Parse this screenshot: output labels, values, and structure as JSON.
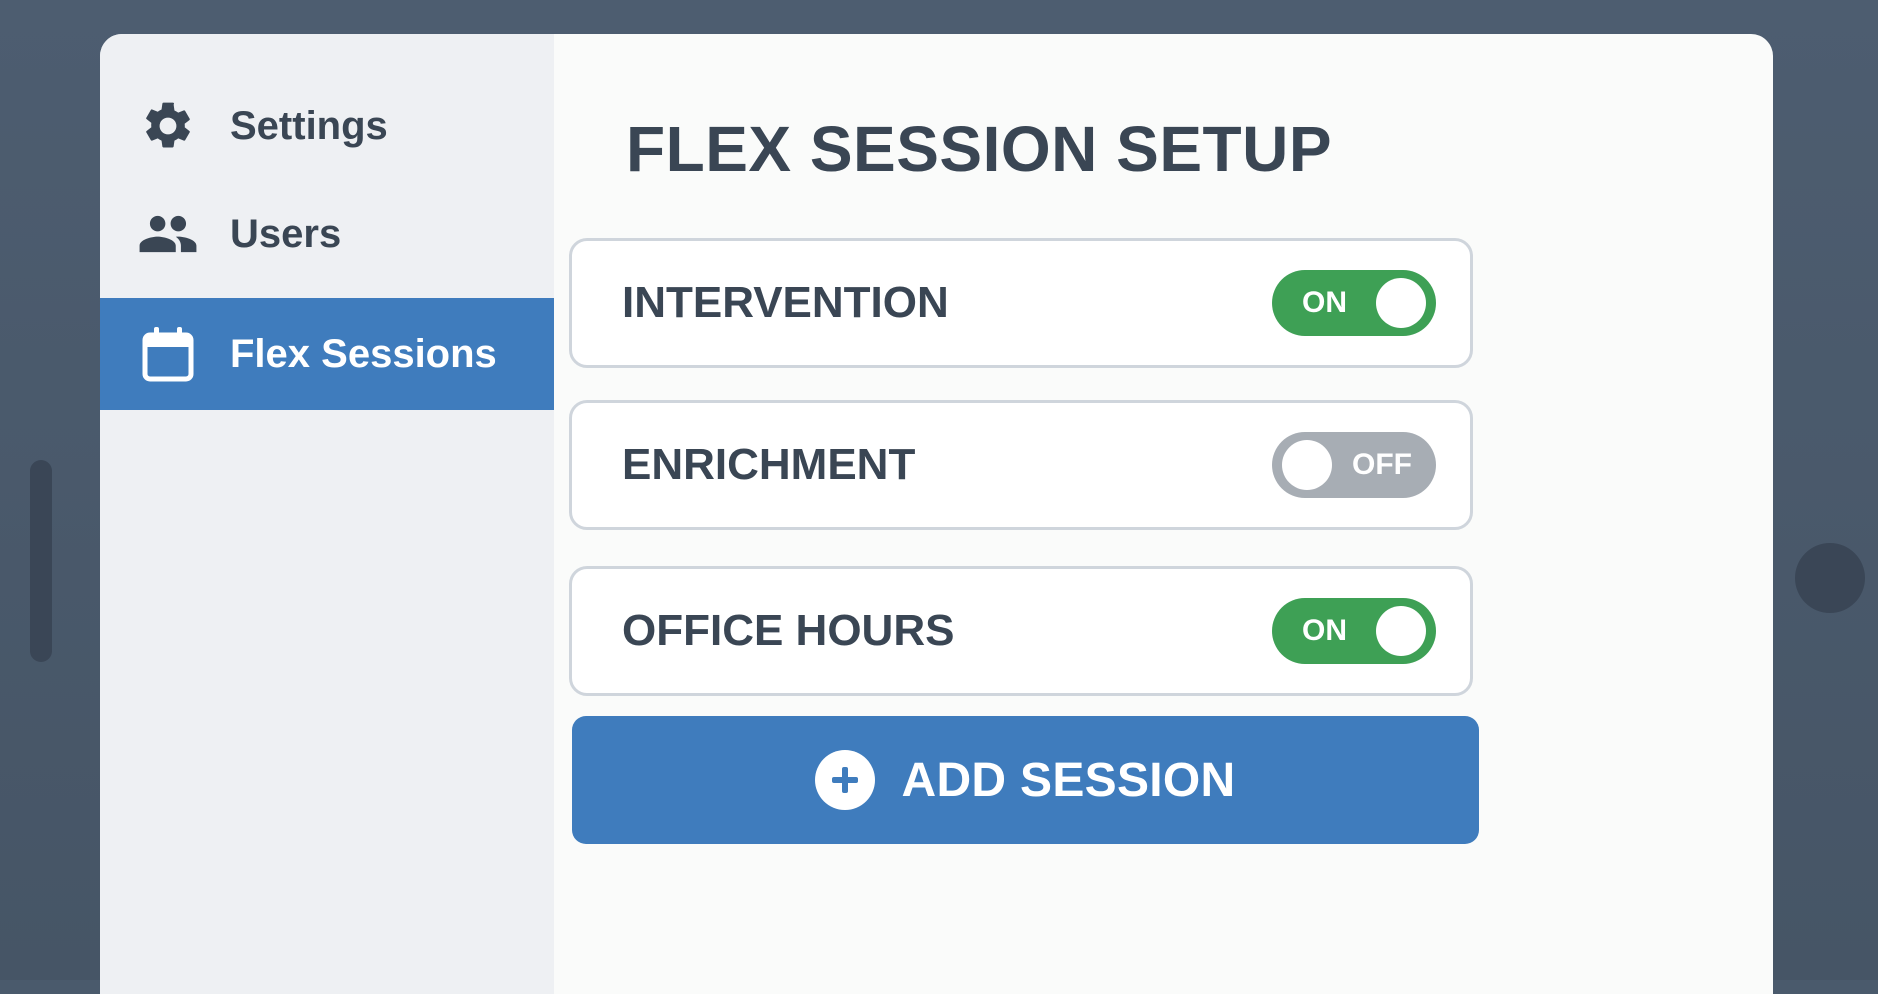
{
  "sidebar": {
    "items": [
      {
        "label": "Settings",
        "icon": "gear-icon",
        "active": false
      },
      {
        "label": "Users",
        "icon": "users-icon",
        "active": false
      },
      {
        "label": "Flex Sessions",
        "icon": "calendar-icon",
        "active": true
      }
    ]
  },
  "main": {
    "title": "FLEX SESSION SETUP",
    "sessions": [
      {
        "label": "INTERVENTION",
        "state": "ON",
        "enabled": true
      },
      {
        "label": "ENRICHMENT",
        "state": "OFF",
        "enabled": false
      },
      {
        "label": "OFFICE HOURS",
        "state": "ON",
        "enabled": true
      }
    ],
    "add_button": {
      "label": "ADD SESSION",
      "icon": "plus-circle-icon"
    }
  },
  "colors": {
    "accent": "#3f7cbd",
    "toggle_on": "#3ea055",
    "toggle_off": "#a7adb4",
    "text": "#3a4654",
    "sidebar_bg": "#eef0f3"
  }
}
